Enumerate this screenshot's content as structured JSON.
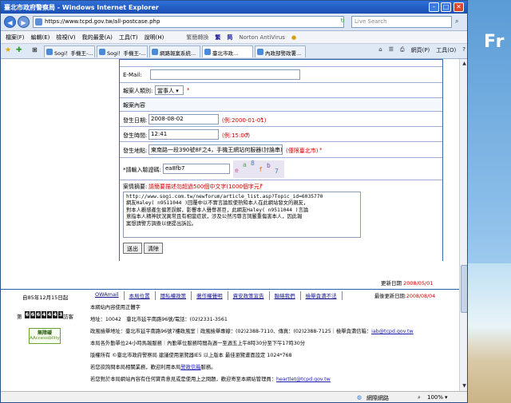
{
  "browser": {
    "title": "臺北市政府警察局 - Windows Internet Explorer",
    "url": "https://www.tcpd.gov.tw/all-postcase.php",
    "search_placeholder": "Live Search",
    "menus": [
      "檔案(F)",
      "編輯(E)",
      "檢視(V)",
      "我的最愛(A)",
      "工具(T)",
      "說明(H)"
    ],
    "translate_label": "繁簡轉換",
    "translate_value": "繁",
    "translate_simple": "简",
    "norton_label": "Norton AntiVirus",
    "tabs": [
      "Sogi！手機王-...",
      "Sogi！手機王-...",
      "網路報案系統...",
      "臺北市政...",
      "內政部警政署..."
    ],
    "toolbar": {
      "page": "網頁(P)",
      "tools": "工具(O)"
    },
    "status_zone": "網際網路",
    "zoom": "100%"
  },
  "form": {
    "email_label": "E-Mail:",
    "reporter_type_label": "報案人類別:",
    "reporter_type_value": "當事人",
    "section_title": "報案內容",
    "date_label": "發生日期:",
    "date_value": "2008-08-02",
    "date_hint": "(例:2000-01-01)",
    "time_label": "發生時間:",
    "time_value": "12:41",
    "time_hint": "(例:15:00)",
    "location_label": "發生地點:",
    "location_value": "東南路一段390號8F之4，手機王網站何服器(討論串)",
    "location_hint": "(僅限臺北市)",
    "captcha_label": "*請輸入驗證碼:",
    "captcha_value": "ea8fb7",
    "captcha_chars": [
      "e",
      "a",
      "8",
      "f",
      "b",
      "7"
    ],
    "summary_label": "案情摘要:",
    "summary_hint": "請簡要描述勿超過500個中文字(1000個字元)",
    "summary_text": "http://www.sogi.com.tw/newforum/article_list.asp?Topic_id=6035770\n網友Haley( n9511044 )回覆中以不實言論欺使熟知本人在此網站發文的親友，\n對本人觀感產生偏差誤解，影響本人聲譽甚巨，此網友Haley( n9511044 )言論\n意指本人精神狀況異常且有相當症狀，涉及公然污辱言詞嚴重傷害本人，因此報\n案想請警方調查以便提出訴訟。",
    "submit_label": "送出",
    "clear_label": "清除",
    "star": "*"
  },
  "page": {
    "updated_label": "更新日期",
    "updated_value": "2008/05/01"
  },
  "footer": {
    "since": "自85年12月15日起",
    "visitor_prefix": "第",
    "visitor_digits": [
      "6",
      "6",
      "6",
      "4",
      "4",
      "4",
      "3"
    ],
    "visitor_suffix": "訪客",
    "accessibility_badge": "無障礙",
    "accessibility_sub": "AAccessibility",
    "links": [
      "OWAmail",
      "本局位置",
      "隱私權政策",
      "著作權聲明",
      "資安政策宣告",
      "聯絡我們",
      "檢舉貪瀆不法"
    ],
    "last_updated_label": "最後更新日期:",
    "last_updated_value": "2008/08/04",
    "lines": [
      "本網站內容使用正體字",
      "地址：10042　臺北市延平南路96號/電話：(02)2331-3561",
      "政風檢舉地址：臺北市延平南路96號7樓政風室｜政風檢舉專線：(02)2388-7110、傳真：(02)2388-7125｜檢舉貪瀆信箱：",
      "本局各外勤單位24小時馬報服務｜內勤單位服務時間為週一至週五上午8時30分至下午17時30分",
      "版權所有 ©臺北市政府警察局 建議使用瀏覽器IE5 以上版本 最佳瀏覽畫面設定 1024*768",
      "若您欲詢問本局相關業務，歡迎利用本局",
      "若您對於本局網站內容有任何寶貴意見或是使用上之問題，歡迎寄至本網站管理員："
    ],
    "report_email": "iab@tcpd.gov.tw",
    "mailbox_link": "警政信箱",
    "mailbox_suffix": "服務。",
    "admin_email": "heartlet@tcpd.gov.tw"
  },
  "desktop": {
    "logo": "Fr"
  }
}
